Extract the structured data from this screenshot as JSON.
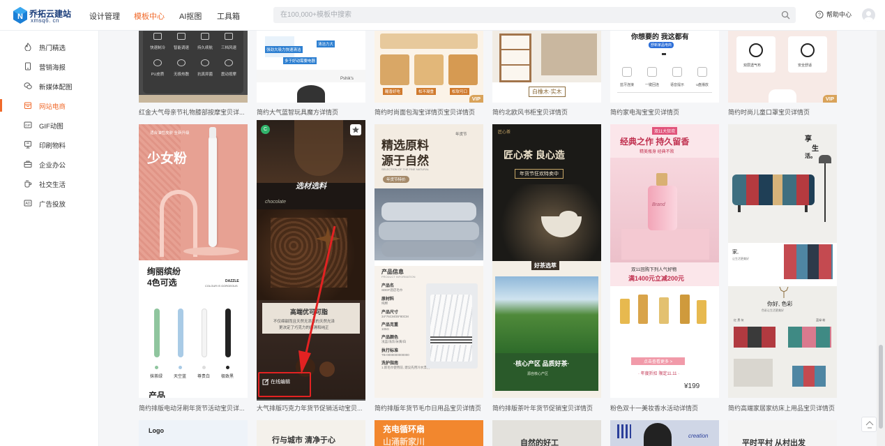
{
  "logo": {
    "name": "乔拓云建站",
    "domain": "xmsq6. cn",
    "mark_letter": "N"
  },
  "nav": [
    "设计管理",
    "模板中心",
    "AI抠图",
    "工具箱"
  ],
  "search": {
    "placeholder": "在100,000+模板中搜索"
  },
  "help_label": "帮助中心",
  "sidebar": [
    "热门精选",
    "营销海报",
    "新媒体配图",
    "网站电商",
    "GIF动图",
    "印刷物料",
    "企业办公",
    "社交生活",
    "广告投放"
  ],
  "row1": {
    "captions": [
      "红金大气母亲节礼物膝部按摩宝贝详...",
      "简约大气蓝智玩具魔方详情页",
      "简约时尚面包淘宝详情页宝贝详情页",
      "简约北欧风书柜宝贝详情页",
      "简约家电淘宝宝贝详情页",
      "简约时尚儿童口罩宝贝详情页"
    ],
    "vip": "VIP",
    "c1_icons": [
      "快速制冷",
      "智能调速",
      "持久续航",
      "三档风速",
      "PU皮质",
      "无极热敷",
      "抗真抑菌",
      "震动按摩"
    ],
    "c2_texts": [
      "强劲大吸力快速清洁",
      "清洁力大",
      "多于好动需要电器"
    ],
    "c2_brand": "Pshik's",
    "c3_texts": [
      "醒香好吃",
      "松不凝重",
      "松软可口"
    ],
    "c4_text": "白橡木·实木",
    "c5_head": "你想要的 我这都有",
    "c5_sub": "舒新家品电商",
    "c5_icons": [
      "蓝牙连接",
      "一键回连",
      "语音提示",
      "u盘播放"
    ],
    "c6_icons": [
      "双层透气布",
      "安全舒适"
    ]
  },
  "row2": {
    "captions": [
      "简约排版电动牙刷年货节活动宝贝详...",
      "大气排版巧克力年货节促销活动宝贝...",
      "简约排版年货节毛巾日用品宝贝详情页",
      "简约排版茶叶年货节促销宝贝详情页",
      "粉色双十一美妆香水活动详情页",
      "简约高端家居家纺床上用品宝贝详情页"
    ],
    "toothbrush": {
      "tag": "适合油性皮肤 全新升级",
      "title": "少女粉",
      "head1": "绚丽缤纷",
      "head2": "4色可选",
      "side1": "DAZZLE",
      "side2": "COLOUR IS GORGEOUS",
      "colors": [
        "抹茶绿",
        "天空蓝",
        "尊贵白",
        "极致黑"
      ],
      "foot": "产品"
    },
    "chocolate": {
      "badge": "C",
      "title": "选材选料",
      "script": "chocolate",
      "body1": "高端优可可脂",
      "body2": "不仅绵甜而且天然无添加的天然光泽",
      "body3": "更决定了巧克力的顺滑和纯正",
      "edit_label": "在线编辑"
    },
    "towel": {
      "tag": "年货节",
      "title1": "精选原料",
      "title2": "源于自然",
      "sub": "SELECTION OF THE FINE NATURAL",
      "badge": "年货节特价",
      "info_title": "产品信息",
      "info_en": "PRODUCT INFORMATION",
      "fields": [
        [
          "产品名",
          "SDDF酒店毛巾"
        ],
        [
          "原材料",
          "纯棉"
        ],
        [
          "产品尺寸",
          "34*76CM/35*80CM"
        ],
        [
          "产品克重",
          "105G"
        ],
        [
          "产品颜色",
          "浅蓝/浅灰/米黄/白"
        ],
        [
          "执行标准",
          "TB-0000000000000"
        ],
        [
          "洗护指南",
          "1.新毛巾使用前, 建议先用冷水漂洗"
        ]
      ]
    },
    "tea": {
      "brand": "匠心茶",
      "title": "匠心茶 良心造",
      "sub": "年货节狂欢特卖中",
      "mid": "好茶选萃",
      "band": "·核心产区 品质好茶·",
      "foot": "源自核心产区"
    },
    "perfume": {
      "tag": "双11大狂欢",
      "title": "经典之作 持久留香",
      "sub": "精美瓶身 经典不败",
      "brand": "Brand",
      "promo1": "双11回购下列人气好物",
      "promo2": "满1400元立减200元",
      "btn": "点击查看更多 >",
      "foot": "· 年度折扣 限定11.11 ·",
      "price": "¥199"
    },
    "sofa": {
      "t1": "享",
      "t2": "生",
      "t3": "活。",
      "s1": "家,",
      "s2": "让生活更美好",
      "mid1": "你好, 色彩",
      "mid2": "色彩让生活更美好",
      "lab1": "红·黑·灰",
      "lab2": "蓝绿·粉"
    }
  },
  "row3": {
    "texts": [
      "Logo",
      "行与城市 清净于心",
      "充电循环扇",
      "山涌新家川",
      "creation",
      "平时平村 从村出发",
      "自然的好工"
    ]
  }
}
